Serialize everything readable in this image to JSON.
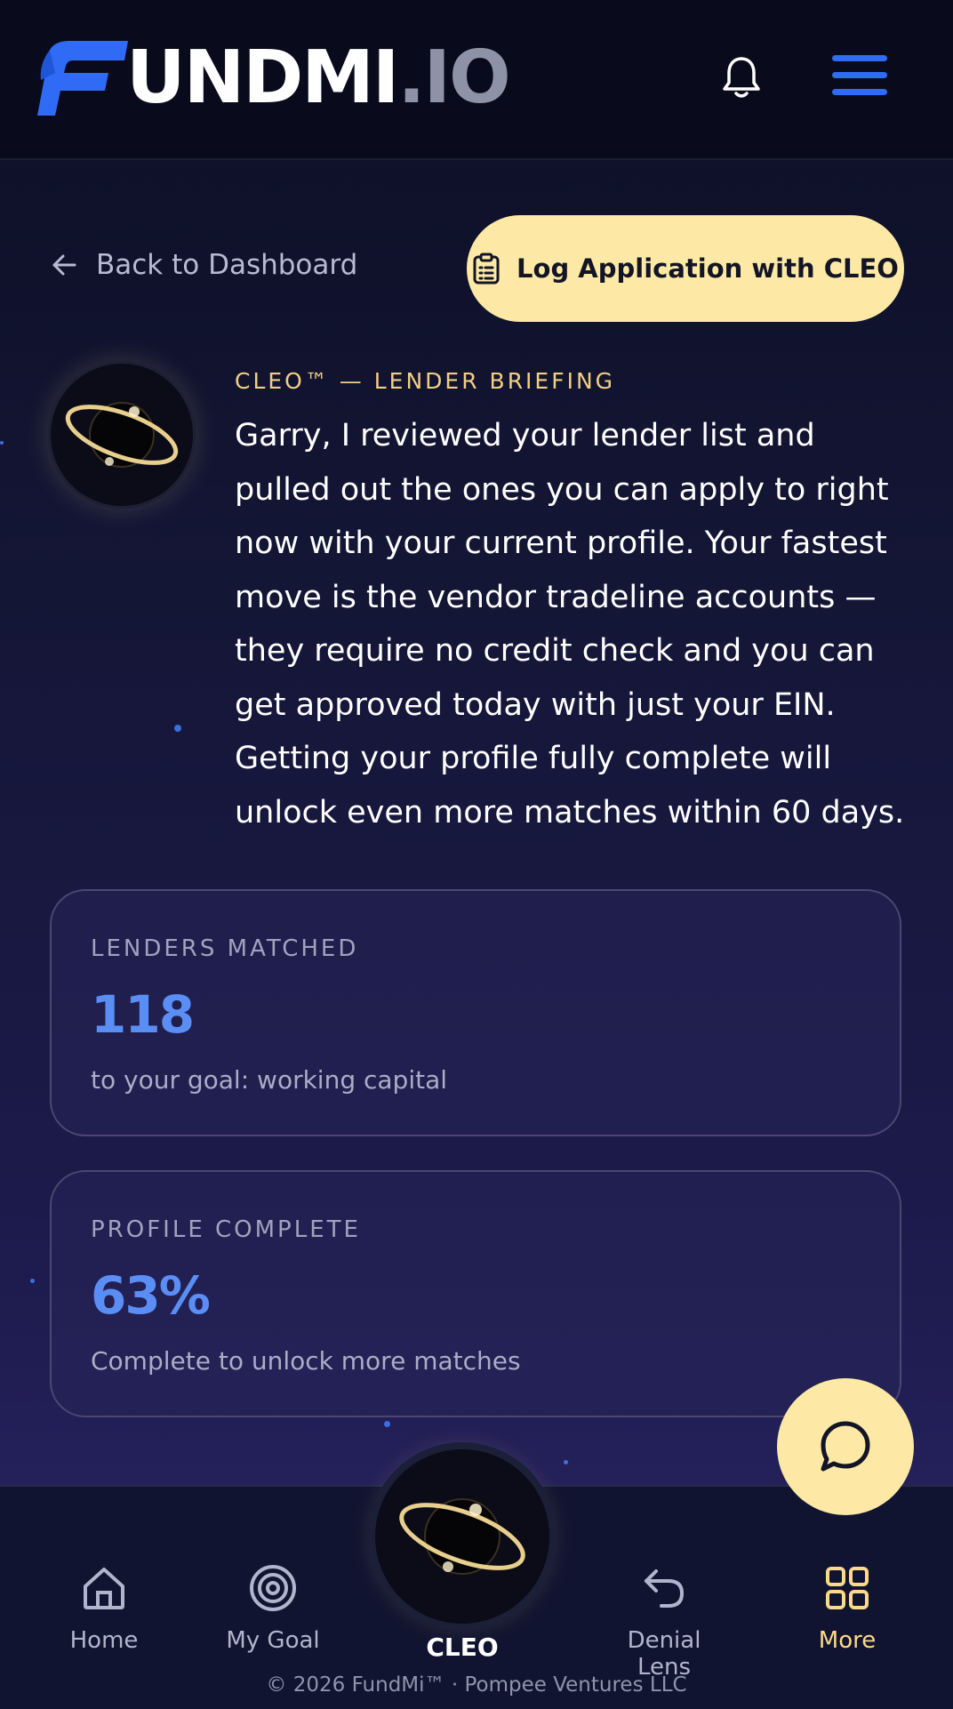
{
  "header": {
    "logo_main": "UNDMI",
    "logo_io": ".IO"
  },
  "back_link": "Back to Dashboard",
  "log_button": "Log Application with CLEO",
  "briefing": {
    "label": "CLEO™ — LENDER BRIEFING",
    "text": "Garry, I reviewed your lender list and pulled out the ones you can apply to right now with your current profile. Your fastest move is the vendor tradeline accounts — they require no credit check and you can get approved today with just your EIN. Getting your profile fully complete will unlock even more matches within 60 days."
  },
  "cards": [
    {
      "label": "LENDERS MATCHED",
      "value": "118",
      "sub": "to your goal: working capital"
    },
    {
      "label": "PROFILE COMPLETE",
      "value": "63%",
      "sub": "Complete to unlock more matches"
    }
  ],
  "nav": {
    "home": "Home",
    "goal": "My Goal",
    "cleo": "CLEO",
    "denial": "Denial Lens",
    "more": "More"
  },
  "footer": "© 2026 FundMi™ · Pompee Ventures LLC",
  "colors": {
    "accent": "#2f6bf5",
    "gold": "#fde9a5",
    "value_blue": "#5b8ef5"
  }
}
